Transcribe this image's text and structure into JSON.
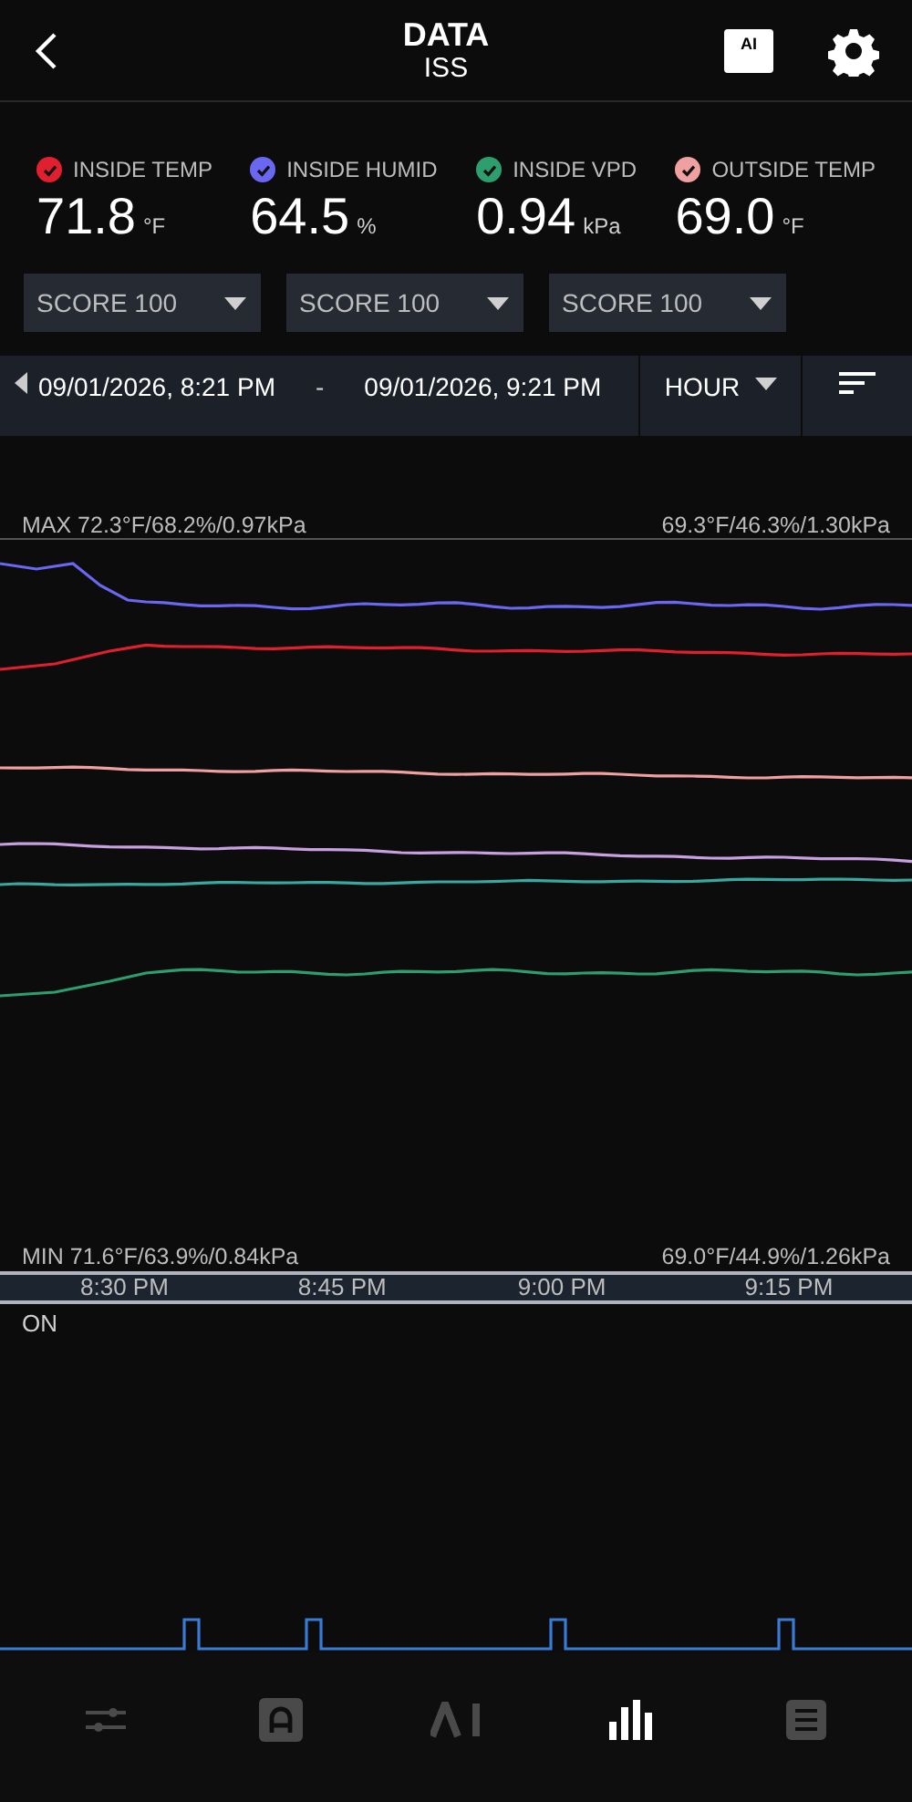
{
  "header": {
    "title": "DATA",
    "subtitle": "ISS",
    "ai_label": "AI"
  },
  "sensors": [
    {
      "label": "INSIDE TEMP",
      "value": "71.8",
      "unit": "°F",
      "checked": true,
      "color": "#e0202e"
    },
    {
      "label": "INSIDE HUMID",
      "value": "64.5",
      "unit": "%",
      "checked": true,
      "color": "#6a67f0"
    },
    {
      "label": "INSIDE VPD",
      "value": "0.94",
      "unit": "kPa",
      "checked": true,
      "color": "#2e9e6e"
    },
    {
      "label": "OUTSIDE TEMP",
      "value": "69.0",
      "unit": "°F",
      "checked": true,
      "color": "#f0a0a0"
    }
  ],
  "dropdowns": [
    "SCORE 100",
    "SCORE 100",
    "SCORE 100"
  ],
  "range": {
    "start": "09/01/2026, 8:21 PM",
    "separator": "-",
    "end": "09/01/2026, 9:21 PM",
    "period": "HOUR"
  },
  "chart": {
    "max_left": "MAX 72.3°F/68.2%/0.97kPa",
    "max_right": "69.3°F/46.3%/1.30kPa",
    "min_left": "MIN 71.6°F/63.9%/0.84kPa",
    "min_right": "69.0°F/44.9%/1.26kPa",
    "times": [
      "8:30 PM",
      "8:45 PM",
      "9:00 PM",
      "9:15 PM"
    ]
  },
  "switch_chart": {
    "label": "ON"
  },
  "nav": [
    {
      "selected": false
    },
    {
      "selected": false
    },
    {
      "selected": false
    },
    {
      "selected": true
    },
    {
      "selected": false
    }
  ]
}
